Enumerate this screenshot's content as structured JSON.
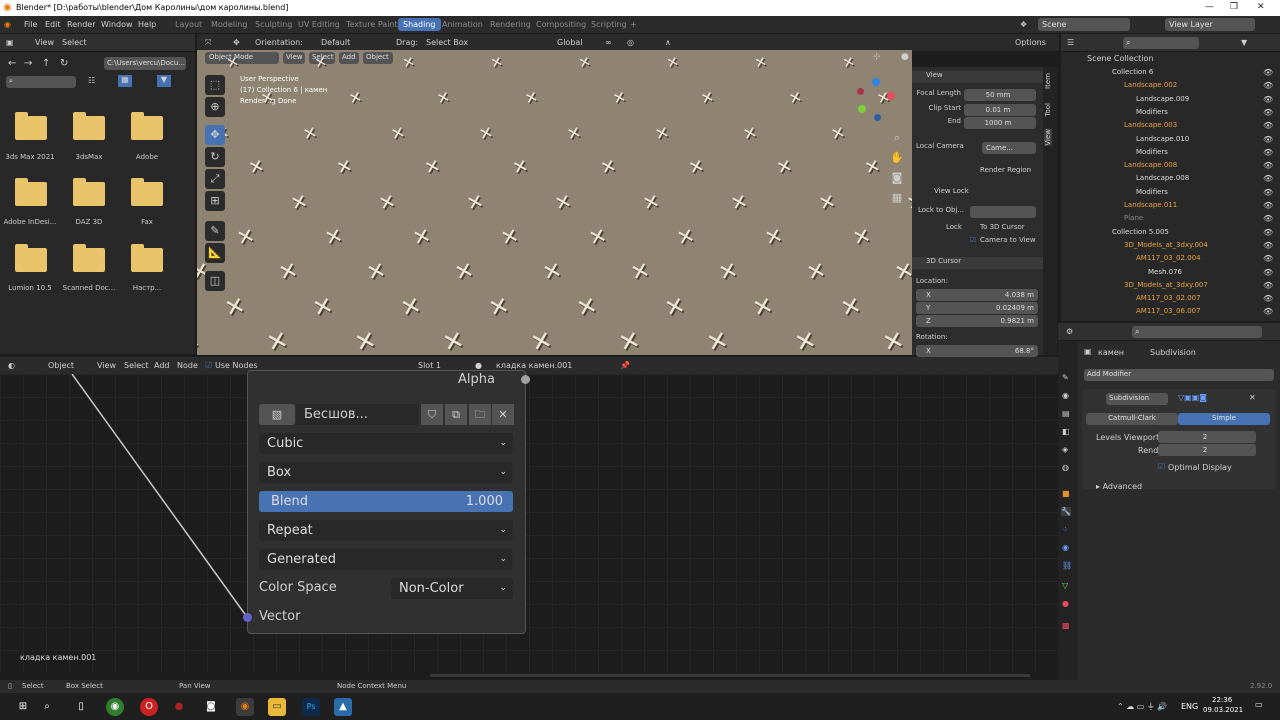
{
  "window": {
    "title": "Blender* [D:\\работы\\blender\\Дом Каролины\\дом каролины.blend]"
  },
  "menu": {
    "file": "File",
    "edit": "Edit",
    "render": "Render",
    "window": "Window",
    "help": "Help"
  },
  "workspaces": [
    "Layout",
    "Modeling",
    "Sculpting",
    "UV Editing",
    "Texture Paint",
    "Shading",
    "Animation",
    "Rendering",
    "Compositing",
    "Scripting"
  ],
  "active_workspace": "Shading",
  "scene": {
    "name": "Scene",
    "view_layer": "View Layer"
  },
  "filebrowser": {
    "view": "View",
    "select": "Select",
    "path": "C:\\Users\\vercu\\Docu...",
    "items": [
      "3ds Max 2021",
      "3dsMax",
      "Adobe",
      "Adobe InDesi...",
      "DAZ 3D",
      "Fax",
      "Lumion 10.5",
      "Scanned Doc...",
      "Настр..."
    ]
  },
  "viewport_header": {
    "orientation_label": "Orientation:",
    "orientation": "Default",
    "drag_label": "Drag:",
    "drag": "Select Box",
    "transform": "Global",
    "options": "Options",
    "mode": "Object Mode",
    "view": "View",
    "select": "Select",
    "add": "Add",
    "object": "Object"
  },
  "viewport_overlay": {
    "line1": "User Perspective",
    "line2": "(17) Collection 6 | камен",
    "line3": "Rendering Done"
  },
  "npanel": {
    "section_view": "View",
    "focal_length_label": "Focal Length",
    "focal_length": "50 mm",
    "clip_start_label": "Clip Start",
    "clip_start": "0.01 m",
    "end_label": "End",
    "end": "1000 m",
    "local_camera_label": "Local Camera",
    "local_camera": "Came...",
    "render_region": "Render Region",
    "view_lock": "View Lock",
    "lock_to_obj": "Lock to Obj...",
    "lock_label": "Lock",
    "to_3d_cursor": "To 3D Cursor",
    "camera_to_view": "Camera to View",
    "section_cursor": "3D Cursor",
    "location_label": "Location:",
    "x_label": "X",
    "x": "4.038 m",
    "y_label": "Y",
    "y": "0.02409 m",
    "z_label": "Z",
    "z": "0.9821 m",
    "rotation_label": "Rotation:",
    "rx": "68.8°",
    "tabs": [
      "Item",
      "Tool",
      "View"
    ]
  },
  "outliner": {
    "root": "Scene Collection",
    "rows": [
      "Collection 6",
      "Landscape.002",
      "Landscape.009",
      "Modifiers",
      "Landscape.003",
      "Landscape.010",
      "Modifiers",
      "Landscape.008",
      "Landscape.008",
      "Modifiers",
      "Landscape.011",
      "Plane",
      "Collection 5.005",
      "3D_Models_at_3dxy.004",
      "AM117_03_02.004",
      "Mesh.076",
      "3D_Models_at_3dxy.007",
      "AM117_03_02.007",
      "AM117_03_06.007"
    ]
  },
  "properties": {
    "object": "камен",
    "modifier_tab": "Subdivision",
    "add_modifier": "Add Modifier",
    "modifier_name": "Subdivision",
    "catmull": "Catmull-Clark",
    "simple": "Simple",
    "levels_label": "Levels Viewport",
    "levels": "2",
    "render_label": "Render",
    "render": "2",
    "optimal": "Optimal Display",
    "advanced": "Advanced"
  },
  "node_header": {
    "editor": "Object",
    "view": "View",
    "select": "Select",
    "add": "Add",
    "node": "Node",
    "use_nodes": "Use Nodes",
    "slot": "Slot 1",
    "material": "кладка камен.001"
  },
  "node": {
    "alpha": "Alpha",
    "image": "Бесшов...",
    "interpolation": "Cubic",
    "projection": "Box",
    "blend_label": "Blend",
    "blend_value": "1.000",
    "extension": "Repeat",
    "source": "Generated",
    "color_space_label": "Color Space",
    "color_space": "Non-Color",
    "vector": "Vector"
  },
  "node_footer": "кладка камен.001",
  "statusbar": {
    "select": "Select",
    "box_select": "Box Select",
    "pan_view": "Pan View",
    "context": "Node Context Menu",
    "version": "2.92.0"
  },
  "taskbar": {
    "lang": "ENG",
    "time": "22:36",
    "date": "09.03.2021"
  }
}
